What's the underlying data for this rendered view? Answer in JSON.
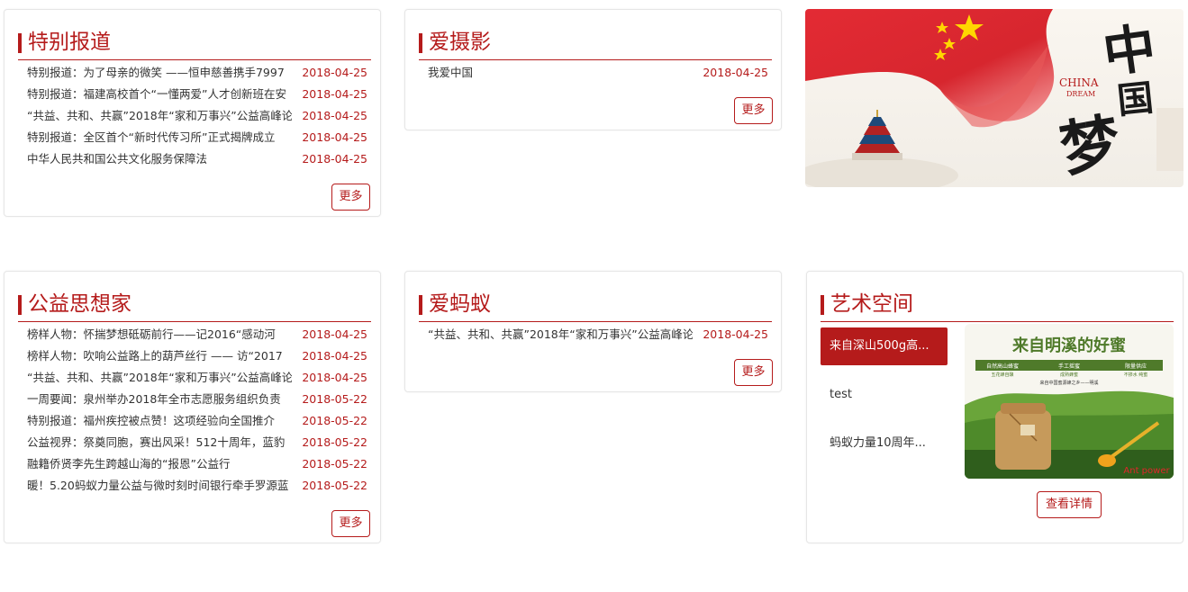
{
  "special": {
    "title": "特别报道",
    "items": [
      {
        "text": "特别报道：为了母亲的微笑 ——恒申慈善携手7997",
        "date": "2018-04-25"
      },
      {
        "text": "特别报道：福建高校首个“一懂两爱”人才创新班在安",
        "date": "2018-04-25"
      },
      {
        "text": "“共益、共和、共赢”2018年“家和万事兴”公益高峰论",
        "date": "2018-04-25"
      },
      {
        "text": "特别报道：全区首个“新时代传习所”正式揭牌成立",
        "date": "2018-04-25"
      },
      {
        "text": "中华人民共和国公共文化服务保障法",
        "date": "2018-04-25"
      }
    ],
    "more": "更多"
  },
  "photo": {
    "title": "爱摄影",
    "items": [
      {
        "text": "我爱中国",
        "date": "2018-04-25"
      }
    ],
    "more": "更多"
  },
  "banner": {
    "logo_big": "中国梦",
    "logo_en_1": "CHINA",
    "logo_en_2": "DREAM"
  },
  "thinker": {
    "title": "公益思想家",
    "items": [
      {
        "text": "榜样人物：怀揣梦想砥砺前行——记2016“感动河",
        "date": "2018-04-25"
      },
      {
        "text": "榜样人物：吹响公益路上的葫芦丝行 —— 访“2017",
        "date": "2018-04-25"
      },
      {
        "text": "“共益、共和、共赢”2018年“家和万事兴”公益高峰论",
        "date": "2018-04-25"
      },
      {
        "text": "一周要闻：泉州举办2018年全市志愿服务组织负责",
        "date": "2018-05-22"
      },
      {
        "text": "特别报道：福州疾控被点赞！这项经验向全国推介",
        "date": "2018-05-22"
      },
      {
        "text": "公益视界：祭奠同胞，赛出风采！512十周年，蓝豹",
        "date": "2018-05-22"
      },
      {
        "text": "融籍侨贤李先生跨越山海的“报恩”公益行",
        "date": "2018-05-22"
      },
      {
        "text": "暖！5.20蚂蚁力量公益与微时刻时间银行牵手罗源蓝",
        "date": "2018-05-22"
      }
    ],
    "more": "更多"
  },
  "ant": {
    "title": "爱蚂蚁",
    "items": [
      {
        "text": "“共益、共和、共赢”2018年“家和万事兴”公益高峰论",
        "date": "2018-04-25"
      }
    ],
    "more": "更多"
  },
  "art": {
    "title": "艺术空间",
    "tabs": [
      "来自深山500g高...",
      "test",
      "蚂蚁力量10周年..."
    ],
    "image": {
      "headline": "来自明溪的好蜜",
      "tags": [
        "自然高山蜂蜜",
        "手工摇蜜",
        "限量供应"
      ],
      "subtags": [
        "五花蜂自酿",
        "成熟蜂蜜",
        "不掺水 纯蜜"
      ],
      "origin": "来自中国蜜源蜂之乡——明溪",
      "brand": "Ant power"
    },
    "detail": "查看详情"
  },
  "colors": {
    "accent": "#b51b1b",
    "date": "#b51b1b",
    "border": "#e6e6e6"
  }
}
